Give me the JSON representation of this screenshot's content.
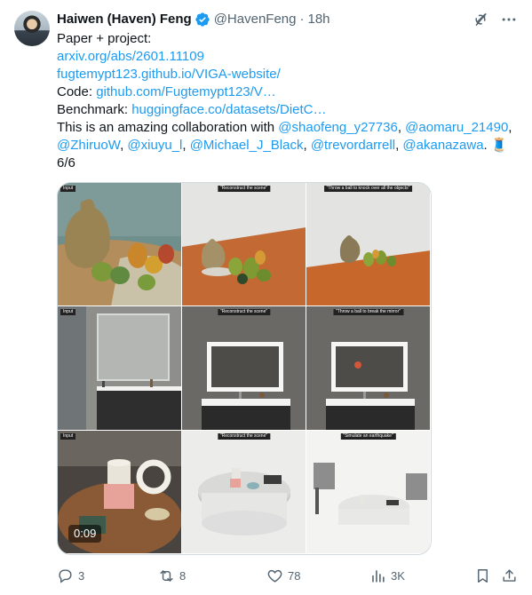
{
  "author": {
    "name": "Haiwen (Haven) Feng",
    "handle": "@HavenFeng",
    "separator": "·",
    "time": "18h"
  },
  "text": {
    "line1": "Paper + project:",
    "link_arxiv": "arxiv.org/abs/2601.11109",
    "link_site": "fugtemypt123.github.io/VIGA-website/",
    "code_label": "Code: ",
    "link_code": "github.com/Fugtemypt123/V…",
    "bench_label": "Benchmark: ",
    "link_bench": "huggingface.co/datasets/DietC…",
    "collab_prefix": "This is an amazing collaboration with ",
    "mention_1": "@shaofeng_y27736",
    "sep_1": ", ",
    "mention_2": "@aomaru_21490",
    "sep_2": ",",
    "mention_3": "@ZhiruoW",
    "sep_3": ", ",
    "mention_4": "@xiuyu_l",
    "sep_4": ", ",
    "mention_5": "@Michael_J_Black",
    "sep_5": ", ",
    "mention_6": "@trevordarrell",
    "sep_6": ", ",
    "mention_7": "@akanazawa",
    "end": ". 🧵",
    "counter": "6/6"
  },
  "media": {
    "tags": {
      "input": "Input",
      "reconstruct": "\"Reconstruct the scene\"",
      "throw_ball": "\"Throw a ball to knock over all the objects\"",
      "throw_ball_mirror": "\"Throw a ball to break the mirror\"",
      "earthquake": "\"Simulate an earthquake\""
    },
    "video_time": "0:09"
  },
  "actions": {
    "replies": "3",
    "reposts": "8",
    "likes": "78",
    "views": "3K"
  },
  "colors": {
    "link": "#1d9bf0",
    "muted": "#536471",
    "text": "#0f1419",
    "verified": "#1d9bf0"
  },
  "icons": [
    "verified-badge-icon",
    "grok-icon",
    "more-icon",
    "reply-icon",
    "repost-icon",
    "like-icon",
    "views-icon",
    "bookmark-icon",
    "share-icon"
  ]
}
